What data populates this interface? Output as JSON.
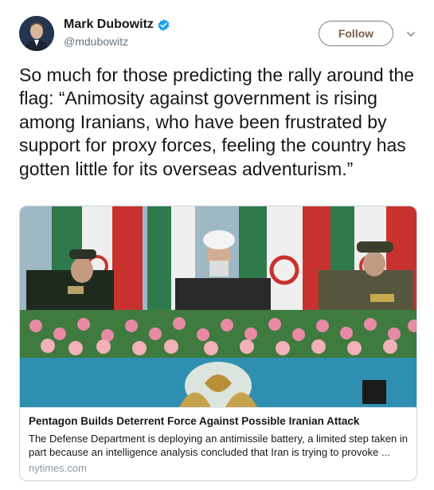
{
  "author": {
    "display_name": "Mark Dubowitz",
    "handle": "@mdubowitz",
    "verified_icon": "verified-badge-icon",
    "avatar_icon": "profile-photo"
  },
  "actions": {
    "follow_label": "Follow",
    "more_icon": "chevron-down-icon"
  },
  "tweet": {
    "text": "So much for those predicting the rally around the flag: “Animosity against government is rising among Iranians, who have been frustrated by support for proxy forces, feeling the country has gotten little for its overseas adventurism.”"
  },
  "card": {
    "title": "Pentagon Builds Deterrent Force Against Possible Iranian Attack",
    "description": "The Defense Department is deploying an antimissile battery, a limited step taken in part because an intelligence analysis concluded that Iran is trying to provoke ...",
    "domain": "nytimes.com",
    "image_subject": "military-parade-photo"
  },
  "colors": {
    "verified_blue": "#1da1f2",
    "follow_text": "#7a5c45",
    "secondary_text": "#657786"
  }
}
